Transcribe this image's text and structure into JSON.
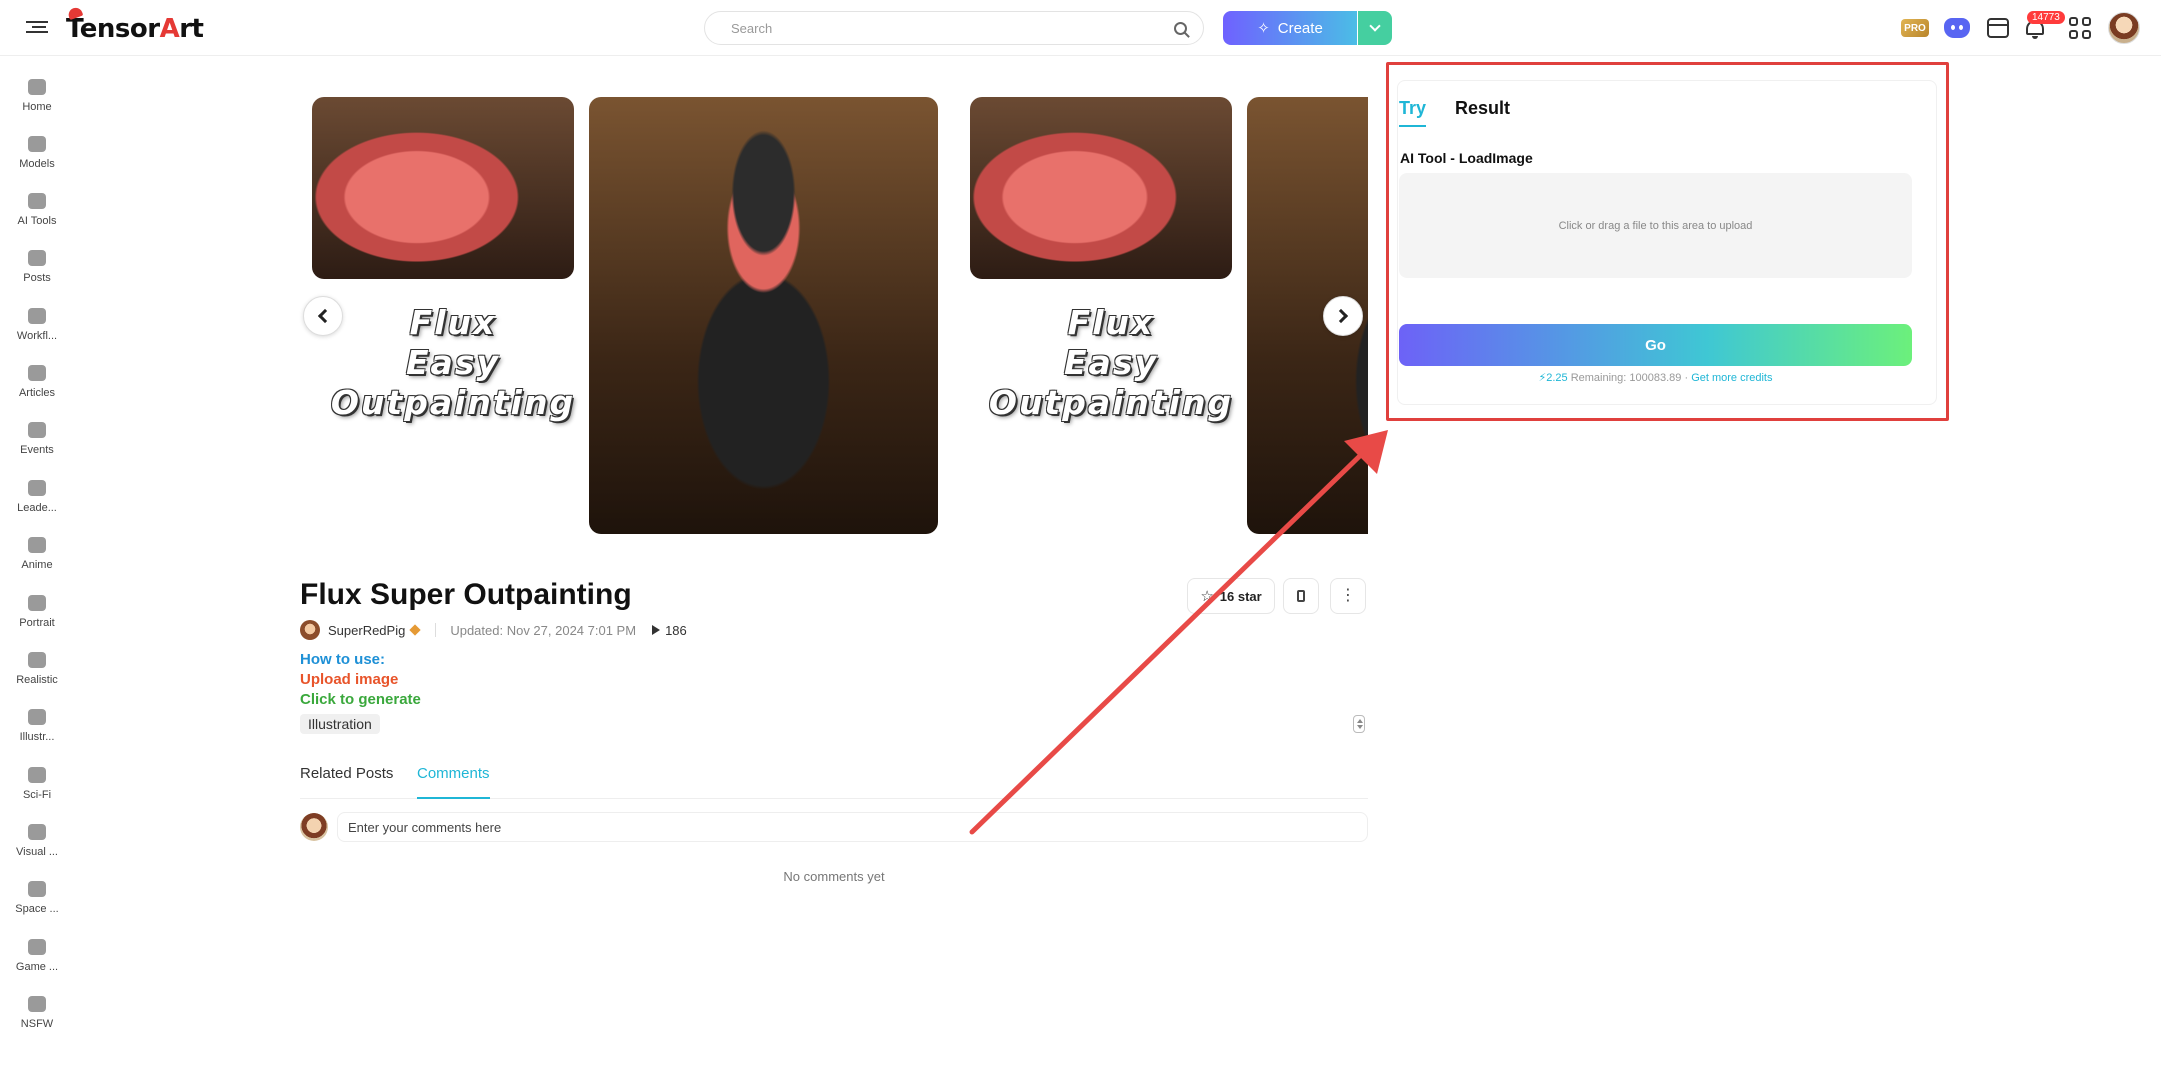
{
  "header": {
    "logo": {
      "prefix": "Tensor",
      "accent": "A",
      "suffix": "rt"
    },
    "search_placeholder": "Search",
    "create_label": "Create",
    "pro_label": "PRO",
    "notification_count": "14773"
  },
  "sidebar": {
    "items": [
      {
        "label": "Home"
      },
      {
        "label": "Models"
      },
      {
        "label": "AI Tools"
      },
      {
        "label": "Posts"
      },
      {
        "label": "Workfl..."
      },
      {
        "label": "Articles"
      },
      {
        "label": "Events"
      },
      {
        "label": "Leade..."
      },
      {
        "label": "Anime"
      },
      {
        "label": "Portrait"
      },
      {
        "label": "Realistic"
      },
      {
        "label": "Illustr..."
      },
      {
        "label": "Sci-Fi"
      },
      {
        "label": "Visual ..."
      },
      {
        "label": "Space ..."
      },
      {
        "label": "Game ..."
      },
      {
        "label": "NSFW"
      }
    ]
  },
  "carousel": {
    "overlay_text": [
      "Flux",
      "Easy",
      "Outpainting"
    ]
  },
  "post": {
    "title": "Flux Super Outpainting",
    "author": "SuperRedPig",
    "updated": "Updated: Nov 27, 2024 7:01 PM",
    "runs": "186",
    "star_label": "16 star",
    "howto_title": "How to use:",
    "step1": "Upload image",
    "step2": "Click to generate",
    "tag": "Illustration",
    "colors": {
      "howto": "#1e90d6",
      "step1": "#e8542a",
      "step2": "#3aa83c"
    }
  },
  "tabs": {
    "related": "Related Posts",
    "comments": "Comments"
  },
  "comments": {
    "placeholder": "Enter your comments here",
    "empty_text": "No comments yet"
  },
  "try_panel": {
    "tab_try": "Try",
    "tab_result": "Result",
    "tool_label": "AI Tool - LoadImage",
    "upload_text": "Click or drag a file to this area to upload",
    "go_label": "Go",
    "cost": "2.25",
    "remaining": "Remaining: 100083.89",
    "more_credits": "Get more credits"
  }
}
